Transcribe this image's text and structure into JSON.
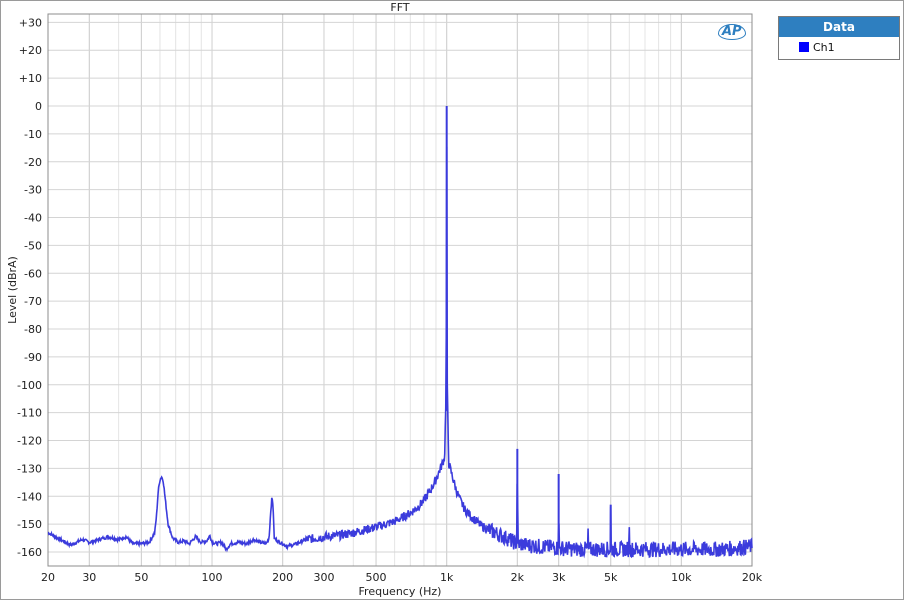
{
  "chart_data": {
    "type": "line",
    "title": "FFT",
    "xlabel": "Frequency (Hz)",
    "ylabel": "Level (dBrA)",
    "x_scale": "log",
    "xlim": [
      20,
      20000
    ],
    "ylim": [
      -165,
      33
    ],
    "grid": true,
    "x_ticks": [
      {
        "v": 20,
        "label": "20"
      },
      {
        "v": 30,
        "label": "30"
      },
      {
        "v": 50,
        "label": "50"
      },
      {
        "v": 100,
        "label": "100"
      },
      {
        "v": 200,
        "label": "200"
      },
      {
        "v": 300,
        "label": "300"
      },
      {
        "v": 500,
        "label": "500"
      },
      {
        "v": 1000,
        "label": "1k"
      },
      {
        "v": 2000,
        "label": "2k"
      },
      {
        "v": 3000,
        "label": "3k"
      },
      {
        "v": 5000,
        "label": "5k"
      },
      {
        "v": 10000,
        "label": "10k"
      },
      {
        "v": 20000,
        "label": "20k"
      }
    ],
    "y_ticks": [
      {
        "v": 30,
        "label": "+30"
      },
      {
        "v": 20,
        "label": "+20"
      },
      {
        "v": 10,
        "label": "+10"
      },
      {
        "v": 0,
        "label": "0"
      },
      {
        "v": -10,
        "label": "-10"
      },
      {
        "v": -20,
        "label": "-20"
      },
      {
        "v": -30,
        "label": "-30"
      },
      {
        "v": -40,
        "label": "-40"
      },
      {
        "v": -50,
        "label": "-50"
      },
      {
        "v": -60,
        "label": "-60"
      },
      {
        "v": -70,
        "label": "-70"
      },
      {
        "v": -80,
        "label": "-80"
      },
      {
        "v": -90,
        "label": "-90"
      },
      {
        "v": -100,
        "label": "-100"
      },
      {
        "v": -110,
        "label": "-110"
      },
      {
        "v": -120,
        "label": "-120"
      },
      {
        "v": -130,
        "label": "-130"
      },
      {
        "v": -140,
        "label": "-140"
      },
      {
        "v": -150,
        "label": "-150"
      },
      {
        "v": -160,
        "label": "-160"
      }
    ],
    "series": [
      {
        "name": "Ch1",
        "color": "#3b3bdc",
        "points": [
          [
            20,
            -153
          ],
          [
            22,
            -155
          ],
          [
            25,
            -157.5
          ],
          [
            28,
            -155.5
          ],
          [
            30,
            -156.5
          ],
          [
            33,
            -155.5
          ],
          [
            36,
            -154.5
          ],
          [
            40,
            -155.5
          ],
          [
            43,
            -154.5
          ],
          [
            46,
            -157
          ],
          [
            50,
            -157
          ],
          [
            54,
            -156.5
          ],
          [
            57,
            -153
          ],
          [
            58,
            -147
          ],
          [
            59,
            -138
          ],
          [
            60,
            -134
          ],
          [
            61,
            -133
          ],
          [
            62,
            -134.5
          ],
          [
            63,
            -140
          ],
          [
            65,
            -150
          ],
          [
            68,
            -155
          ],
          [
            72,
            -156.5
          ],
          [
            76,
            -156
          ],
          [
            80,
            -157
          ],
          [
            85,
            -154.5
          ],
          [
            90,
            -156.5
          ],
          [
            95,
            -156
          ],
          [
            98,
            -154
          ],
          [
            100,
            -156.5
          ],
          [
            105,
            -157
          ],
          [
            110,
            -156.5
          ],
          [
            115,
            -159
          ],
          [
            120,
            -157
          ],
          [
            130,
            -156.5
          ],
          [
            140,
            -157
          ],
          [
            150,
            -155.5
          ],
          [
            160,
            -156.5
          ],
          [
            170,
            -157
          ],
          [
            175,
            -155
          ],
          [
            178,
            -145
          ],
          [
            180,
            -140.5
          ],
          [
            182,
            -143
          ],
          [
            184,
            -155
          ],
          [
            190,
            -156
          ],
          [
            200,
            -157
          ],
          [
            210,
            -158
          ],
          [
            230,
            -157
          ],
          [
            250,
            -155.5
          ],
          [
            280,
            -155
          ],
          [
            300,
            -154.5
          ],
          [
            350,
            -154
          ],
          [
            400,
            -153
          ],
          [
            450,
            -152
          ],
          [
            500,
            -151
          ],
          [
            550,
            -150
          ],
          [
            600,
            -149
          ],
          [
            650,
            -147.5
          ],
          [
            700,
            -146
          ],
          [
            750,
            -144
          ],
          [
            800,
            -141.5
          ],
          [
            850,
            -138
          ],
          [
            900,
            -134
          ],
          [
            950,
            -129
          ],
          [
            980,
            -126
          ],
          [
            995,
            -100
          ],
          [
            1000,
            0
          ],
          [
            1005,
            -100
          ],
          [
            1020,
            -128
          ],
          [
            1050,
            -132
          ],
          [
            1100,
            -138
          ],
          [
            1150,
            -142
          ],
          [
            1200,
            -145
          ],
          [
            1300,
            -148
          ],
          [
            1400,
            -150.5
          ],
          [
            1600,
            -153
          ],
          [
            1800,
            -155
          ],
          [
            1990,
            -157
          ],
          [
            2000,
            -123
          ],
          [
            2010,
            -157
          ],
          [
            2200,
            -157.5
          ],
          [
            2500,
            -158
          ],
          [
            2990,
            -158.5
          ],
          [
            3000,
            -132
          ],
          [
            3010,
            -158.5
          ],
          [
            3500,
            -159
          ],
          [
            3990,
            -159
          ],
          [
            4000,
            -151
          ],
          [
            4010,
            -159
          ],
          [
            4500,
            -159
          ],
          [
            4990,
            -159
          ],
          [
            5000,
            -143
          ],
          [
            5010,
            -159
          ],
          [
            5500,
            -159
          ],
          [
            5990,
            -159
          ],
          [
            6000,
            -149
          ],
          [
            6010,
            -159
          ],
          [
            7000,
            -159
          ],
          [
            8000,
            -159
          ],
          [
            10000,
            -159
          ],
          [
            12000,
            -159
          ],
          [
            15000,
            -159
          ],
          [
            20000,
            -158
          ]
        ]
      }
    ],
    "legend": {
      "title": "Data",
      "position": "top-right-outside"
    }
  },
  "logo_text": "AP"
}
